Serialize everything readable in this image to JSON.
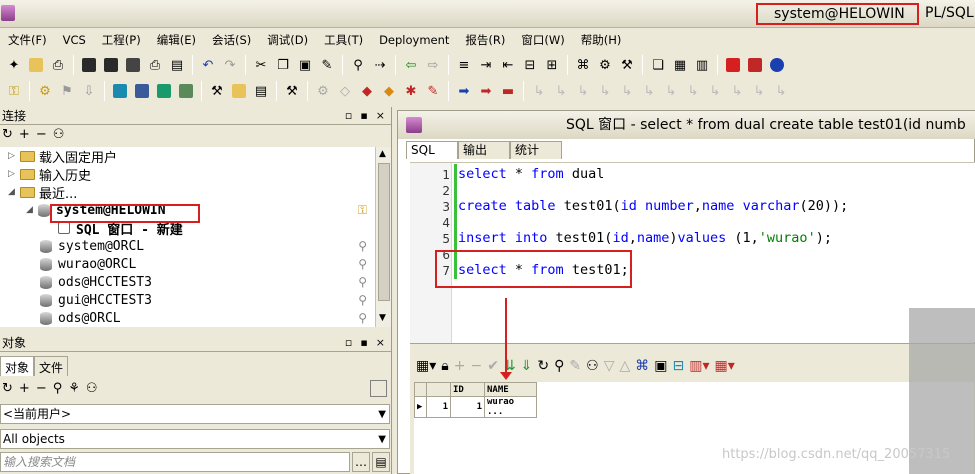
{
  "titlebar": {
    "connection": "system@HELOWIN",
    "app_name": "PL/SQL"
  },
  "menu": [
    "文件(F)",
    "VCS",
    "工程(P)",
    "编辑(E)",
    "会话(S)",
    "调试(D)",
    "工具(T)",
    "Deployment",
    "报告(R)",
    "窗口(W)",
    "帮助(H)"
  ],
  "left": {
    "connections_title": "连接",
    "tree": {
      "pinned": "载入固定用户",
      "history": "输入历史",
      "recent": "最近...",
      "active_conn": "system@HELOWIN",
      "sql_window": "SQL 窗口 - 新建",
      "conns": [
        "system@ORCL",
        "wurao@ORCL",
        "ods@HCCTEST3",
        "gui@HCCTEST3",
        "ods@ORCL"
      ]
    },
    "objects_title": "对象",
    "obj_tabs": [
      "对象",
      "文件"
    ],
    "current_user": "<当前用户>",
    "filter": "All objects",
    "search_placeholder": "输入搜索文档"
  },
  "editor": {
    "title": "SQL 窗口 - select * from dual create table test01(id numb",
    "tabs": [
      "SQL",
      "输出",
      "统计"
    ],
    "line_numbers": [
      "1",
      "2",
      "3",
      "4",
      "5",
      "6",
      "7"
    ],
    "code": {
      "l1": "select * from dual",
      "l3": "create  table  test01(id number,name varchar(20));",
      "l5": "insert into test01(id,name)values (1,'wurao');",
      "l7": "select * from test01;"
    },
    "results": {
      "headers": [
        "",
        "",
        "ID",
        "NAME"
      ],
      "rows": [
        [
          "▶",
          "1",
          "1",
          "wurao ..."
        ]
      ]
    }
  },
  "watermark": "https://blog.csdn.net/qq_20057315"
}
